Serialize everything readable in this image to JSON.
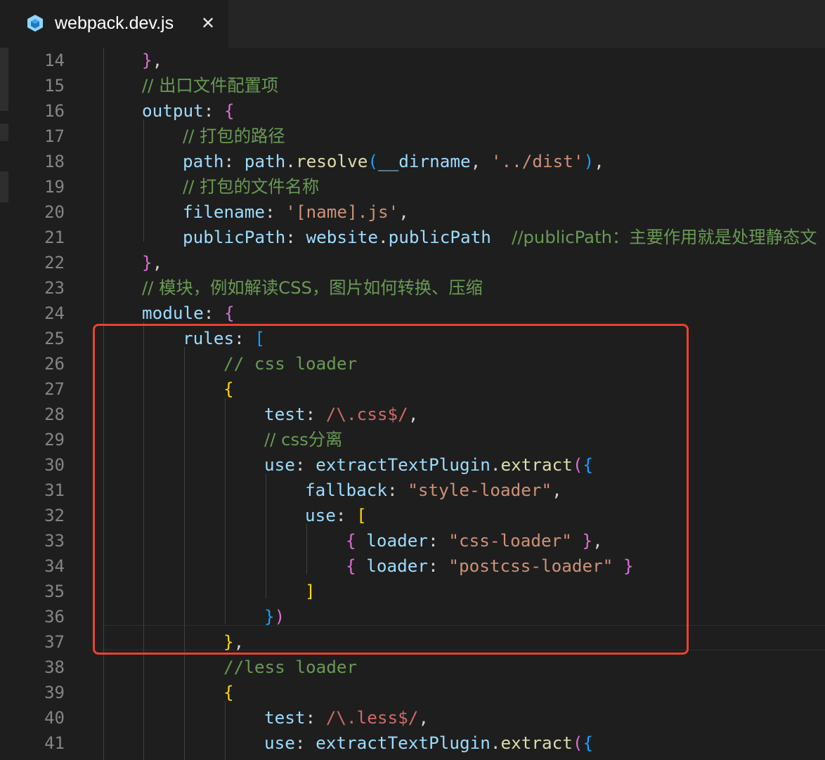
{
  "tab": {
    "filename": "webpack.dev.js",
    "icon": "webpack-cube-icon",
    "close_glyph": "✕"
  },
  "colors": {
    "highlight_box": "#e8432e",
    "property": "#9cdcfe",
    "comment": "#6a9955",
    "string": "#ce9178",
    "function": "#dcdcaa",
    "regex": "#d16969"
  },
  "gutter": {
    "line_numbers": [
      "14",
      "15",
      "16",
      "17",
      "18",
      "19",
      "20",
      "21",
      "22",
      "23",
      "24",
      "25",
      "26",
      "27",
      "28",
      "29",
      "30",
      "31",
      "32",
      "33",
      "34",
      "35",
      "36",
      "37",
      "38",
      "39",
      "40",
      "41"
    ]
  },
  "code": {
    "l14": {
      "t1": "}",
      "t2": ","
    },
    "l15": {
      "t1": "// 出口文件配置项"
    },
    "l16": {
      "t1": "output",
      "t2": ": ",
      "t3": "{"
    },
    "l17": {
      "t1": "// 打包的路径"
    },
    "l18": {
      "t1": "path",
      "t2": ": ",
      "t3": "path",
      "t4": ".",
      "t5": "resolve",
      "t6": "(",
      "t7": "__dirname",
      "t8": ", ",
      "t9": "'../dist'",
      "t10": ")",
      "t11": ","
    },
    "l19": {
      "t1": "// 打包的文件名称"
    },
    "l20": {
      "t1": "filename",
      "t2": ": ",
      "t3": "'[name].js'",
      "t4": ","
    },
    "l21": {
      "t1": "publicPath",
      "t2": ": ",
      "t3": "website",
      "t4": ".",
      "t5": "publicPath",
      "t6": "  ",
      "t7": "//publicPath：主要作用就是处理静态文"
    },
    "l22": {
      "t1": "}",
      "t2": ","
    },
    "l23": {
      "t1": "// 模块，例如解读CSS，图片如何转换、压缩"
    },
    "l24": {
      "t1": "module",
      "t2": ": ",
      "t3": "{"
    },
    "l25": {
      "t1": "rules",
      "t2": ": ",
      "t3": "["
    },
    "l26": {
      "t1": "// css loader"
    },
    "l27": {
      "t1": "{"
    },
    "l28": {
      "t1": "test",
      "t2": ": ",
      "t3": "/\\.css$/",
      "t4": ","
    },
    "l29": {
      "t1": "// css分离"
    },
    "l30": {
      "t1": "use",
      "t2": ": ",
      "t3": "extractTextPlugin",
      "t4": ".",
      "t5": "extract",
      "t6": "(",
      "t7": "{"
    },
    "l31": {
      "t1": "fallback",
      "t2": ": ",
      "t3": "\"style-loader\"",
      "t4": ","
    },
    "l32": {
      "t1": "use",
      "t2": ": ",
      "t3": "["
    },
    "l33": {
      "t1": "{",
      "t2": " ",
      "t3": "loader",
      "t4": ": ",
      "t5": "\"css-loader\"",
      "t6": " ",
      "t7": "}",
      "t8": ","
    },
    "l34": {
      "t1": "{",
      "t2": " ",
      "t3": "loader",
      "t4": ": ",
      "t5": "\"postcss-loader\"",
      "t6": " ",
      "t7": "}"
    },
    "l35": {
      "t1": "]"
    },
    "l36": {
      "t1": "}",
      "t2": ")"
    },
    "l37": {
      "t1": "}",
      "t2": ","
    },
    "l38": {
      "t1": "//less loader"
    },
    "l39": {
      "t1": "{"
    },
    "l40": {
      "t1": "test",
      "t2": ": ",
      "t3": "/\\.less$/",
      "t4": ","
    },
    "l41": {
      "t1": "use",
      "t2": ": ",
      "t3": "extractTextPlugin",
      "t4": ".",
      "t5": "extract",
      "t6": "(",
      "t7": "{"
    }
  }
}
